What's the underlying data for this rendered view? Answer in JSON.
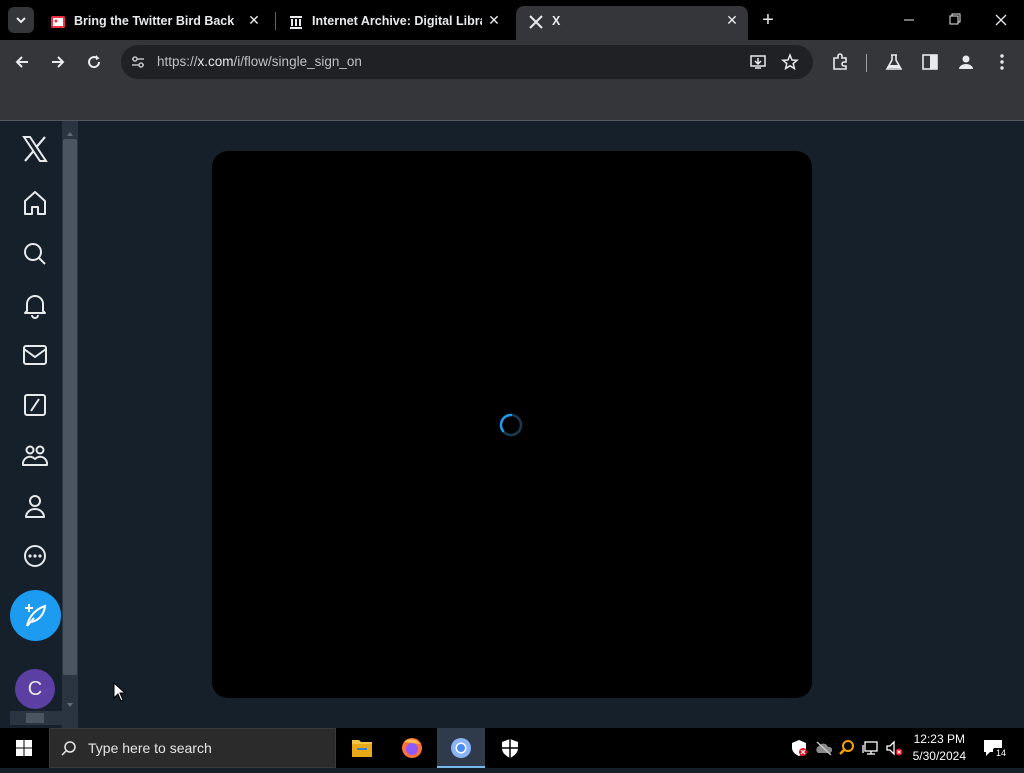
{
  "browser": {
    "tabs": [
      {
        "title": "Bring the Twitter Bird Back",
        "favicon": "image-favicon"
      },
      {
        "title": "Internet Archive: Digital Librar",
        "favicon": "archive-icon"
      },
      {
        "title": "X",
        "favicon": "x-logo-icon",
        "active": true
      }
    ],
    "url": {
      "scheme": "https://",
      "host": "x.com",
      "path": "/i/flow/single_sign_on"
    }
  },
  "page": {
    "logo": "x-logo-icon",
    "nav": [
      "home-icon",
      "search-icon",
      "bell-icon",
      "mail-icon",
      "grok-icon",
      "communities-icon",
      "profile-icon",
      "more-icon"
    ],
    "post_button": "feather-plus-icon",
    "avatar_letter": "C",
    "modal": {
      "state": "loading"
    }
  },
  "taskbar": {
    "search_placeholder": "Type here to search",
    "time": "12:23 PM",
    "date": "5/30/2024",
    "notifications": "14"
  },
  "colors": {
    "accent": "#1d9bf0",
    "background": "#15202b",
    "avatar": "#5b3fa3"
  }
}
